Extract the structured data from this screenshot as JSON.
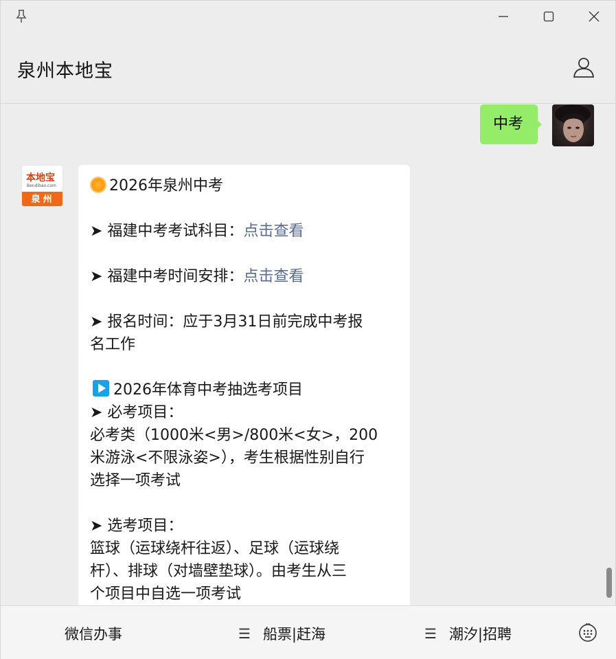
{
  "header": {
    "title": "泉州本地宝"
  },
  "chat": {
    "me": {
      "text": "中考"
    },
    "bot": {
      "avatar": {
        "logo_text": "本地宝",
        "logo_sub": "Bendibao.com",
        "logo_city": "泉州"
      },
      "title": "2026年泉州中考",
      "subjects_label": "➤ 福建中考考试科目：",
      "subjects_link": "点击查看",
      "schedule_label": "➤ 福建中考时间安排：",
      "schedule_link": "点击查看",
      "signup_line1": "➤ 报名时间：应于3月31日前完成中考报",
      "signup_line2": "名工作",
      "pe_title": "2026年体育中考抽选考项目",
      "required_label": "➤ 必考项目：",
      "required_line1": "必考类（1000米<男>/800米<女>，200",
      "required_line2": "米游泳<不限泳姿>），考生根据性别自行",
      "required_line3": "选择一项考试",
      "optional_label": "➤ 选考项目：",
      "optional_line1": "篮球（运球绕杆往返）、足球（运球绕",
      "optional_line2": "杆）、排球（对墙壁垫球）。由考生从三",
      "optional_line3": "个项目中自选一项考试"
    }
  },
  "bottom_menu": {
    "item1": "微信办事",
    "item2": "船票|赶海",
    "item3": "潮汐|招聘",
    "menu_glyph": "☰"
  },
  "icons": [
    "pin-icon",
    "minimize-icon",
    "maximize-icon",
    "close-icon",
    "profile-icon",
    "sun-emoji-icon",
    "play-emoji-icon",
    "keyboard-icon"
  ],
  "colors": {
    "my_bubble": "#95ec69",
    "link": "#576b95",
    "background": "#ededed"
  }
}
